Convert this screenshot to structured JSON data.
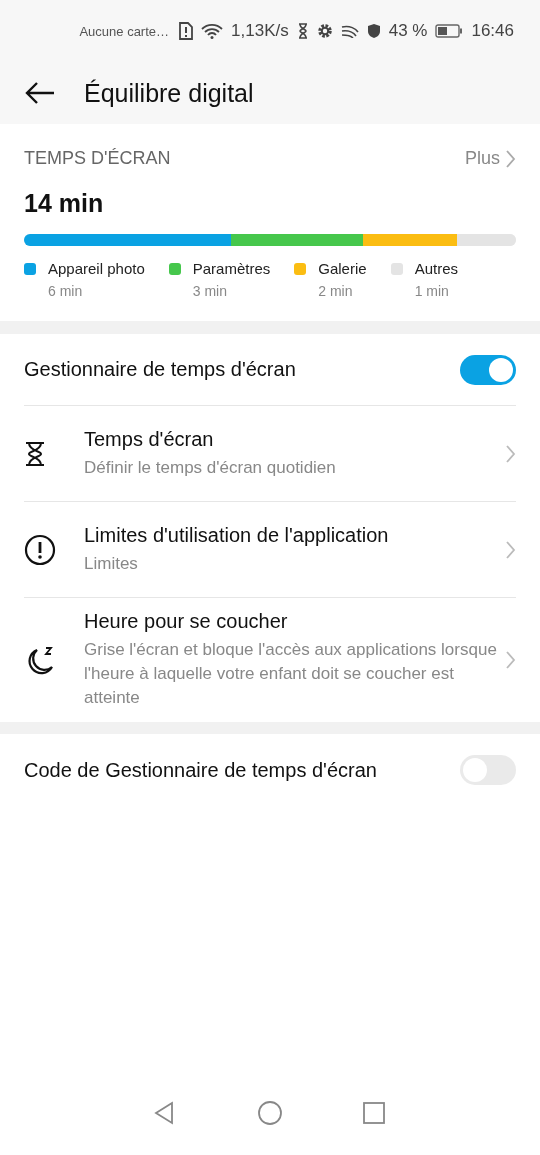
{
  "status_bar": {
    "carrier": "Aucune carte…",
    "speed": "1,13K/s",
    "battery": "43 %",
    "time": "16:46"
  },
  "header": {
    "title": "Équilibre digital"
  },
  "screen_time": {
    "heading": "TEMPS D'ÉCRAN",
    "more": "Plus",
    "total": "14 min",
    "apps": [
      {
        "name": "Appareil photo",
        "time": "6 min",
        "color": "#0aa2e3"
      },
      {
        "name": "Paramètres",
        "time": "3 min",
        "color": "#46c74c"
      },
      {
        "name": "Galerie",
        "time": "2 min",
        "color": "#fbbd12"
      },
      {
        "name": "Autres",
        "time": "1 min",
        "color": "#e4e4e4"
      }
    ]
  },
  "settings": [
    {
      "kind": "toggle",
      "label": "Gestionnaire de temps d'écran",
      "on": true
    },
    {
      "kind": "link",
      "label": "Temps d'écran",
      "subtitle": "Définir le temps d'écran quotidien"
    },
    {
      "kind": "link",
      "label": "Limites d'utilisation de l'application",
      "subtitle": "Limites"
    },
    {
      "kind": "link",
      "label": "Heure pour se coucher",
      "subtitle": "Grise l'écran et bloque l'accès aux applications lorsque l'heure à laquelle votre enfant doit se coucher est atteinte"
    }
  ],
  "code_setting": {
    "kind": "toggle",
    "label": "Code de Gestionnaire de temps d'écran",
    "on": false
  }
}
